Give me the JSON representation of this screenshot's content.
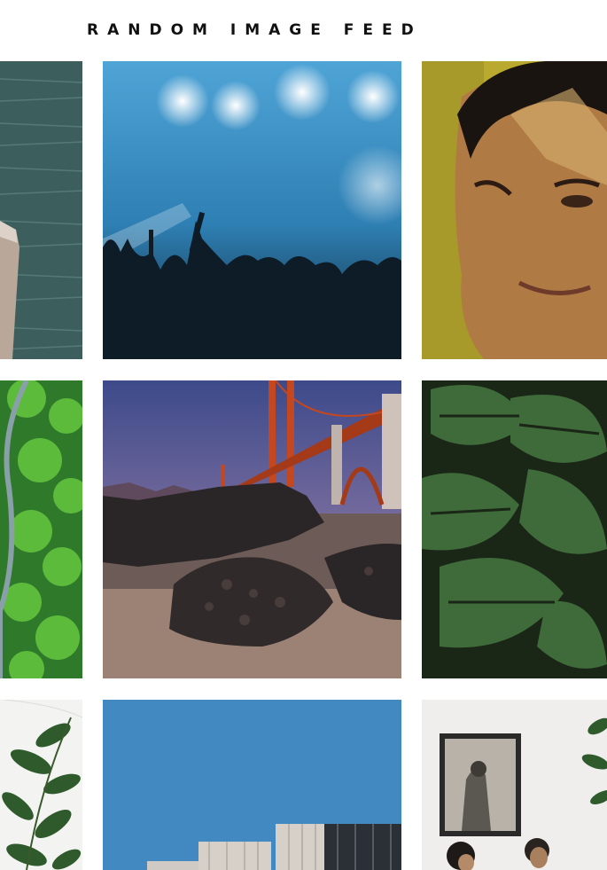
{
  "header": {
    "title": "RANDOM IMAGE FEED"
  }
}
